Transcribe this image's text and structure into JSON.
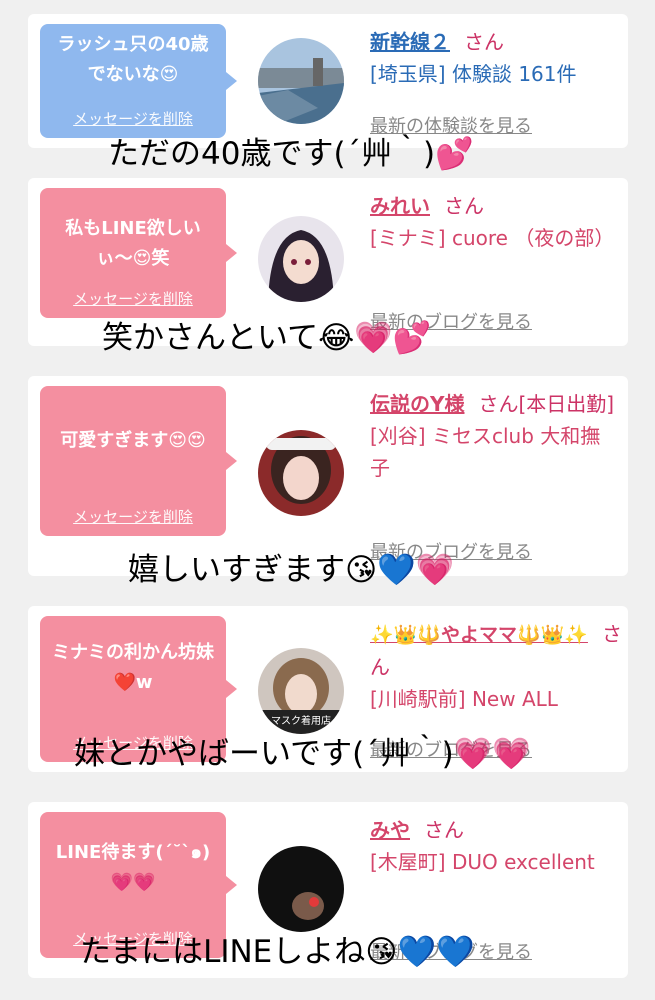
{
  "cards": [
    {
      "message": "ラッシュ只の40歳でないな😍",
      "delete_label": "メッセージを削除",
      "name": "新幹線２",
      "honorific": "さん",
      "detail": "[埼玉県] 体験談 161件",
      "latest_link": "最新の体験談を見る",
      "caption": "ただの40歳です(´艸｀)💕"
    },
    {
      "message": "私もLINE欲しいぃ〜😍笑",
      "delete_label": "メッセージを削除",
      "name": "みれい",
      "honorific": "さん",
      "detail": "[ミナミ] cuore （夜の部）",
      "latest_link": "最新のブログを見る",
      "caption": "笑かさんといて😂💗💕"
    },
    {
      "message": "可愛すぎます😍😍",
      "delete_label": "メッセージを削除",
      "name": "伝説のY様",
      "honorific": "さん[本日出勤]",
      "detail": "[刈谷] ミセスclub 大和撫子",
      "latest_link": "最新のブログを見る",
      "caption": "嬉しいすぎます😘💙💗"
    },
    {
      "message": "ミナミの利かん坊妹❤️w",
      "delete_label": "メッセージを削除",
      "name": "✨👑🔱やよママ🔱👑✨",
      "honorific": "さん",
      "detail": "[川崎駅前] New ALL",
      "latest_link": "最新のブログを見る",
      "avatar_text": "マスク着用店",
      "caption": "妹とかやばーいです(´艸｀)💗💗"
    },
    {
      "message": "LINE待ます(´˘`๑)💗💗",
      "delete_label": "メッセージを削除",
      "name": "みや",
      "honorific": "さん",
      "detail": "[木屋町] DUO excellent",
      "latest_link": "最新のブログを見る",
      "caption": "たまにはLINEしよね😘💙💙"
    }
  ],
  "colors": {
    "bubble_blue": "#8fb8ee",
    "bubble_pink": "#f48fa0",
    "name_blue": "#2a6bb6",
    "name_pink": "#d4456a"
  }
}
